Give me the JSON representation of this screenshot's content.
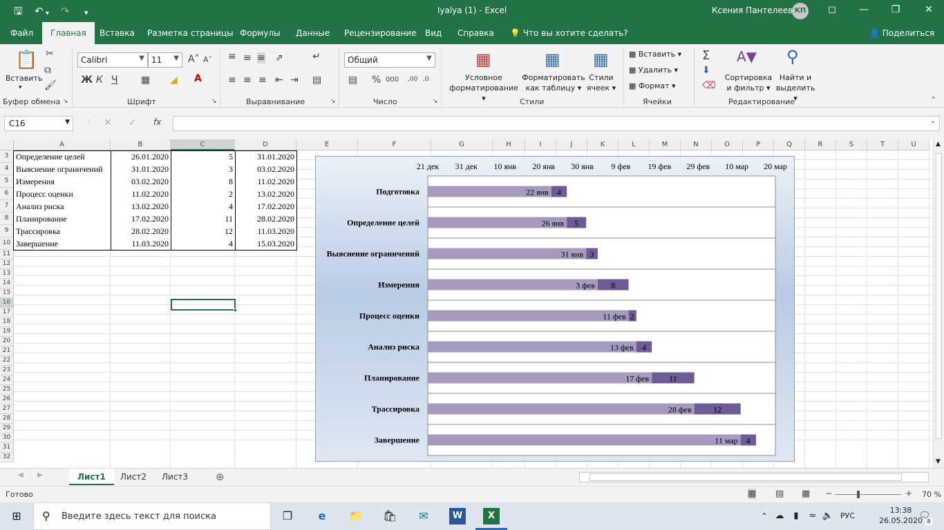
{
  "window": {
    "title": "Iyalya (1)  -  Excel",
    "user": "Ксения Пантелеева",
    "initials": "КП"
  },
  "menu": {
    "file": "Файл",
    "home": "Главная",
    "insert": "Вставка",
    "layout": "Разметка страницы",
    "formulas": "Формулы",
    "data": "Данные",
    "review": "Рецензирование",
    "view": "Вид",
    "help": "Справка",
    "tell": "Что вы хотите сделать?",
    "share": "Поделиться"
  },
  "ribbon": {
    "paste": "Вставить",
    "clipboard": "Буфер обмена",
    "font_name": "Calibri",
    "font_size": "11",
    "bold": "Ж",
    "italic": "К",
    "underline": "Ч",
    "font": "Шрифт",
    "alignment": "Выравнивание",
    "number_format": "Общий",
    "number": "Число",
    "cond_format_1": "Условное",
    "cond_format_2": "форматирование",
    "format_table_1": "Форматировать",
    "format_table_2": "как таблицу",
    "cell_styles_1": "Стили",
    "cell_styles_2": "ячеек",
    "styles": "Стили",
    "cells_insert": "Вставить",
    "cells_delete": "Удалить",
    "cells_format": "Формат",
    "cells": "Ячейки",
    "sort_1": "Сортировка",
    "sort_2": "и фильтр",
    "find_1": "Найти и",
    "find_2": "выделить",
    "editing": "Редактирование"
  },
  "formula_bar": {
    "name_box": "C16",
    "fx": "fx",
    "value": ""
  },
  "columns": [
    "A",
    "B",
    "C",
    "D",
    "E",
    "F",
    "G",
    "H",
    "I",
    "J",
    "K",
    "L",
    "M",
    "N",
    "O",
    "P",
    "Q",
    "R",
    "S",
    "T",
    "U"
  ],
  "rows": [
    "3",
    "4",
    "5",
    "6",
    "7",
    "8",
    "9",
    "10",
    "11",
    "12",
    "13",
    "14",
    "15",
    "16",
    "17",
    "18",
    "19",
    "20",
    "21",
    "22",
    "23",
    "24",
    "25",
    "26",
    "27",
    "28",
    "29",
    "30",
    "31",
    "32"
  ],
  "table": [
    [
      "Определение целей",
      "26.01.2020",
      "5",
      "31.01.2020"
    ],
    [
      "Выяснение ограничений",
      "31.01.2020",
      "3",
      "03.02.2020"
    ],
    [
      "Измерения",
      "03.02.2020",
      "8",
      "11.02.2020"
    ],
    [
      "Процесс оценки",
      "11.02.2020",
      "2",
      "13.02.2020"
    ],
    [
      "Анализ риска",
      "13.02.2020",
      "4",
      "17.02.2020"
    ],
    [
      "Планирование",
      "17.02.2020",
      "11",
      "28.02.2020"
    ],
    [
      "Трассировка",
      "28.02.2020",
      "12",
      "11.03.2020"
    ],
    [
      "Завершение",
      "11.03.2020",
      "4",
      "15.03.2020"
    ]
  ],
  "chart_data": {
    "type": "bar",
    "orientation": "horizontal",
    "stacked": true,
    "x_axis_ticks": [
      "21 дек",
      "31 дек",
      "10 янв",
      "20 янв",
      "30 янв",
      "9 фев",
      "19 фев",
      "29 фев",
      "10 мар",
      "20 мар"
    ],
    "x_range": [
      "2019-12-21",
      "2020-03-20"
    ],
    "categories": [
      "Подготовка",
      "Определение целей",
      "Выяснение ограничений",
      "Измерения",
      "Процесс оценки",
      "Анализ риска",
      "Планирование",
      "Трассировка",
      "Завершение"
    ],
    "series": [
      {
        "values": [
          "2020-01-22",
          "2020-01-26",
          "2020-01-31",
          "2020-02-03",
          "2020-02-11",
          "2020-02-13",
          "2020-02-17",
          "2020-02-28",
          "2020-03-11"
        ],
        "labels": [
          "22 янв",
          "26 янв",
          "31 янв",
          "3 фев",
          "11 фев",
          "13 фев",
          "17 фев",
          "28 фев",
          "11 мар"
        ],
        "color": "#a69bbf"
      },
      {
        "values": [
          4,
          5,
          3,
          8,
          2,
          4,
          11,
          12,
          4
        ],
        "color": "#6e5a96"
      }
    ],
    "grid": false
  },
  "sheets": [
    "Лист1",
    "Лист2",
    "Лист3"
  ],
  "status": {
    "ready": "Готово",
    "zoom": "70 %"
  },
  "taskbar": {
    "search": "Введите здесь текст для поиска",
    "lang": "РУС",
    "time": "13:38",
    "date": "26.05.2020",
    "notif": "8"
  }
}
